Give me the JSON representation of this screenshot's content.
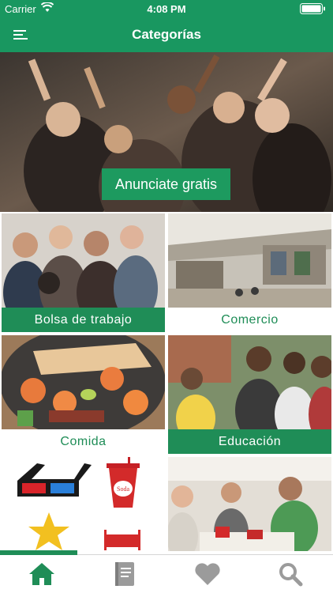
{
  "status_bar": {
    "carrier": "Carrier",
    "time": "4:08 PM"
  },
  "header": {
    "title": "Categorías"
  },
  "hero": {
    "cta_label": "Anunciate gratis"
  },
  "categories": [
    {
      "label": "Bolsa de trabajo"
    },
    {
      "label": "Comercio"
    },
    {
      "label": "Comida"
    },
    {
      "label": "Educación"
    },
    {
      "label": ""
    },
    {
      "label": ""
    }
  ],
  "tab_bar": {
    "tabs": [
      {
        "icon": "home-icon",
        "active": true
      },
      {
        "icon": "book-icon",
        "active": false
      },
      {
        "icon": "heart-icon",
        "active": false
      },
      {
        "icon": "search-icon",
        "active": false
      }
    ]
  },
  "colors": {
    "brand": "#199760",
    "active_tab": "#1f8d57",
    "inactive_tab": "#9b9b9b"
  }
}
